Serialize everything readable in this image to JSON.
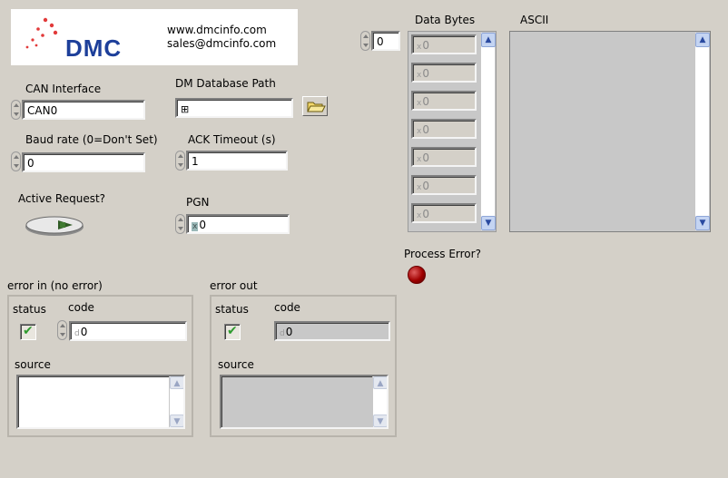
{
  "logo": {
    "brand": "DMC",
    "website": "www.dmcinfo.com",
    "email": "sales@dmcinfo.com"
  },
  "can_interface": {
    "label": "CAN Interface",
    "value": "CAN0"
  },
  "baud_rate": {
    "label": "Baud rate (0=Don't Set)",
    "value": "0"
  },
  "active_request": {
    "label": "Active Request?"
  },
  "dm_database_path": {
    "label": "DM Database Path",
    "value": ""
  },
  "ack_timeout": {
    "label": "ACK Timeout (s)",
    "value": "1"
  },
  "pgn": {
    "label": "PGN",
    "value": "0"
  },
  "array_index": {
    "value": "0"
  },
  "data_bytes": {
    "label": "Data Bytes",
    "values": [
      "0",
      "0",
      "0",
      "0",
      "0",
      "0",
      "0"
    ]
  },
  "ascii": {
    "label": "ASCII",
    "value": ""
  },
  "process_error": {
    "label": "Process Error?"
  },
  "error_in": {
    "title": "error in (no error)",
    "status_label": "status",
    "code_label": "code",
    "code_value": "0",
    "source_label": "source"
  },
  "error_out": {
    "title": "error out",
    "status_label": "status",
    "code_label": "code",
    "code_value": "0",
    "source_label": "source"
  },
  "icons": {
    "radix": "d",
    "radix_x": "x",
    "checkmark": "✔",
    "path_glyph": "⊞"
  },
  "colors": {
    "background": "#d4d0c8",
    "led_red": "#b01010",
    "check_green": "#2e9b2e"
  }
}
